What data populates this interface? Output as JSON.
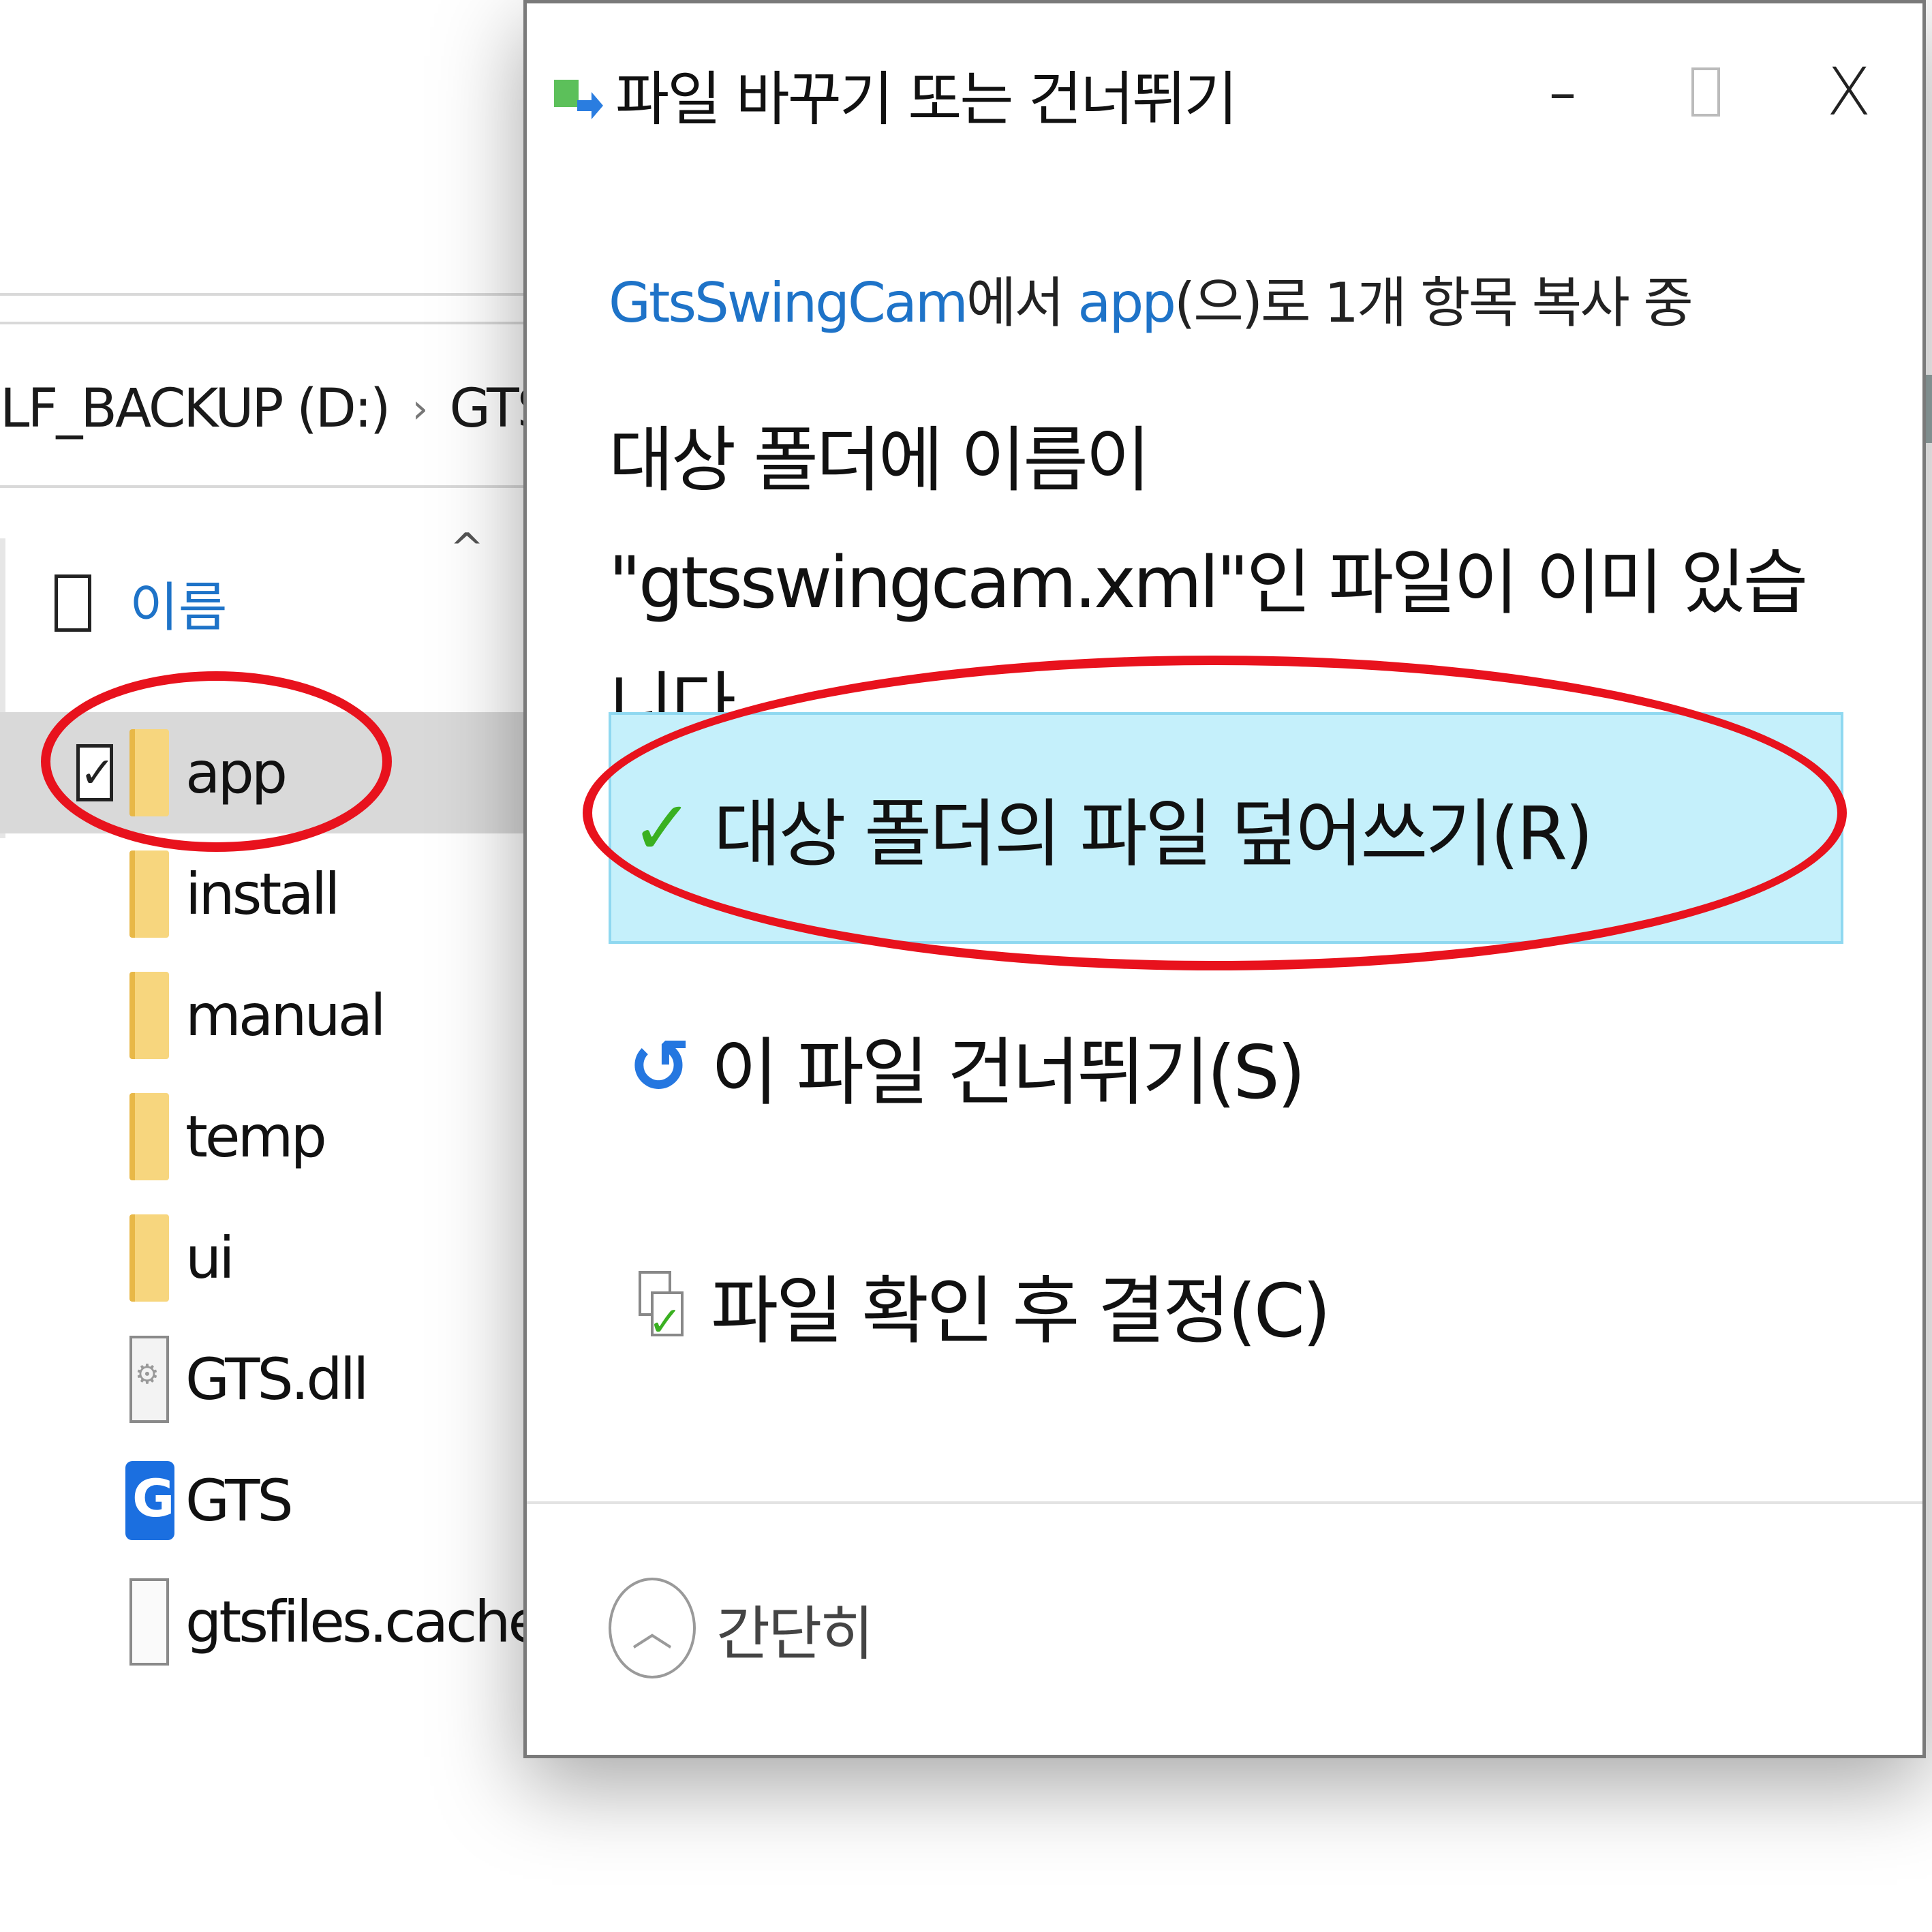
{
  "explorer": {
    "breadcrumb": [
      "LF_BACKUP (D:)",
      "GTS_PRO"
    ],
    "breadcrumb_separator": "›",
    "sort_indicator": "^",
    "column_header": "이름",
    "files": [
      {
        "name": "app",
        "type": "folder",
        "checked": true,
        "selected": true
      },
      {
        "name": "install",
        "type": "folder"
      },
      {
        "name": "manual",
        "type": "folder"
      },
      {
        "name": "temp",
        "type": "folder"
      },
      {
        "name": "ui",
        "type": "folder"
      },
      {
        "name": "GTS.dll",
        "type": "dll"
      },
      {
        "name": "GTS",
        "type": "app"
      },
      {
        "name": "gtsfiles.cache",
        "type": "file"
      }
    ]
  },
  "dialog": {
    "title": "파일 바꾸기 또는 건너뛰기",
    "window_controls": {
      "minimize": "–",
      "maximize": "□",
      "close": "X"
    },
    "status": {
      "source": "GtsSwingCam",
      "mid1": "에서 ",
      "dest": "app",
      "mid2": "(으)로 1개 항목 복사 중"
    },
    "message": "대상 폴더에 이름이 \"gtsswingcam.xml\"인 파일이 이미 있습니다.",
    "options": {
      "replace": "대상 폴더의 파일 덮어쓰기(R)",
      "skip": "이 파일 건너뛰기(S)",
      "compare": "파일 확인 후 결정(C)"
    },
    "collapse_label": "간단히",
    "icons": {
      "replace": "check-icon",
      "skip": "skip-arrow-icon",
      "compare": "compare-files-icon",
      "collapse": "chevron-up-icon"
    }
  },
  "colors": {
    "link": "#1e73c8",
    "highlight": "#c5f0fb",
    "annotation": "#e8121d",
    "check": "#3ab021"
  }
}
